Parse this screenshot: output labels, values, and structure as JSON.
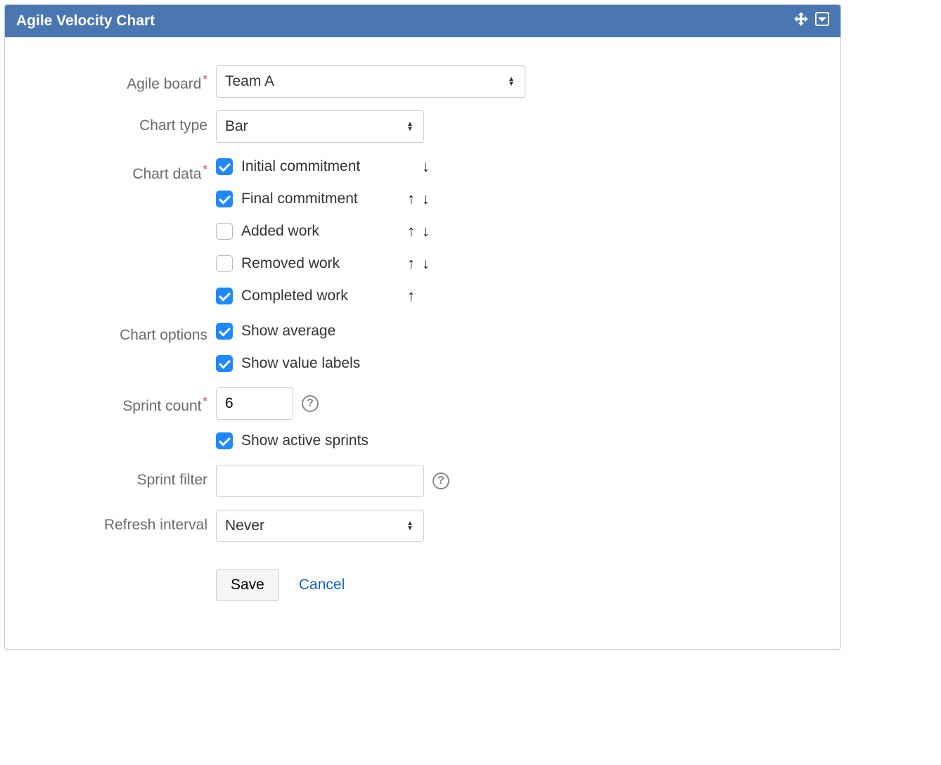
{
  "header": {
    "title": "Agile Velocity Chart"
  },
  "labels": {
    "agile_board": "Agile board",
    "chart_type": "Chart type",
    "chart_data": "Chart data",
    "chart_options": "Chart options",
    "sprint_count": "Sprint count",
    "sprint_filter": "Sprint filter",
    "refresh_interval": "Refresh interval"
  },
  "fields": {
    "agile_board": {
      "value": "Team A"
    },
    "chart_type": {
      "value": "Bar"
    },
    "chart_data": {
      "items": [
        {
          "label": "Initial commitment",
          "checked": true,
          "up": false,
          "down": true
        },
        {
          "label": "Final commitment",
          "checked": true,
          "up": true,
          "down": true
        },
        {
          "label": "Added work",
          "checked": false,
          "up": true,
          "down": true
        },
        {
          "label": "Removed work",
          "checked": false,
          "up": true,
          "down": true
        },
        {
          "label": "Completed work",
          "checked": true,
          "up": true,
          "down": false
        }
      ]
    },
    "chart_options": {
      "items": [
        {
          "label": "Show average",
          "checked": true
        },
        {
          "label": "Show value labels",
          "checked": true
        }
      ]
    },
    "sprint_count": {
      "value": "6"
    },
    "show_active_sprints": {
      "label": "Show active sprints",
      "checked": true
    },
    "sprint_filter": {
      "value": ""
    },
    "refresh_interval": {
      "value": "Never"
    }
  },
  "actions": {
    "save": "Save",
    "cancel": "Cancel"
  }
}
